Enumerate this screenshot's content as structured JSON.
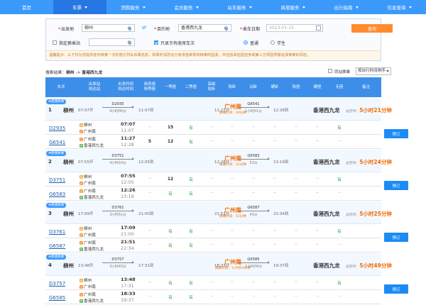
{
  "nav": {
    "items": [
      {
        "label": "首页",
        "caret": false,
        "active": false
      },
      {
        "label": "车票",
        "caret": true,
        "active": true
      },
      {
        "label": "团购服务",
        "caret": true,
        "active": false
      },
      {
        "label": "会员服务",
        "caret": true,
        "active": false
      },
      {
        "label": "站车服务",
        "caret": true,
        "active": false
      },
      {
        "label": "商旅服务",
        "caret": true,
        "active": false
      },
      {
        "label": "出行指南",
        "caret": true,
        "active": false
      },
      {
        "label": "信息查询",
        "caret": true,
        "active": false
      }
    ]
  },
  "search": {
    "from_label": "出发地",
    "from_value": "柳州",
    "to_label": "目的地",
    "to_value": "香港西九龙",
    "date_label": "乘车日期",
    "date_value": "2023-01-15",
    "query_label": "查询",
    "transfer_station_label": "指定换乘站",
    "transfer_station_placeholder": "",
    "only_available_label": "只显示有座席车次",
    "only_available_checked": true,
    "ticket_type_options": [
      "普通",
      "学生"
    ],
    "ticket_type_selected": "普通",
    "notice": "温馨提示：以下仅为您提供途中换乘一次的部分列车余票信息，购票时请您充分考虑各种影响换乘的因素，并自愿承担因自身或第三方原因导致延误换乘的风险。"
  },
  "results": {
    "prefix": "搜索结果：",
    "from": "柳州",
    "sep": " -> ",
    "to": "香港西九龙",
    "same_station_label": "同站换乘",
    "sort_label": "按出行时间排序"
  },
  "table": {
    "headers": [
      "车次",
      "出发站\n到达站",
      "出发时间\n到达时间",
      "商务座\n特等座",
      "一等座",
      "二等座",
      "高级\n软卧",
      "软卧",
      "动卧",
      "硬卧",
      "软座",
      "硬座",
      "无座",
      "备注"
    ]
  },
  "journeys": [
    {
      "badge": "便捷换乘",
      "num": "1",
      "from": "柳州",
      "dep_time": "07:07开",
      "seg1": {
        "code": "D2935",
        "dur": "4小时00分"
      },
      "arr1": "11:07到",
      "transfer_station": "广州南",
      "transfer_info": "换乘时间：20分钟",
      "dep2": "11:27开",
      "seg2": {
        "code": "G6541",
        "dur": "1小时01分"
      },
      "arr2": "12:28到",
      "dest": "香港西九龙",
      "total_label": "总历时：",
      "total": "5小时21分钟",
      "legs": [
        {
          "code": "D2935",
          "from_mk": "始",
          "from": "柳州",
          "to_mk": "过",
          "to": "广州南",
          "dep": "07:07",
          "arr": "11:07",
          "seats": [
            "--",
            "15",
            "有",
            "--",
            "--",
            "--",
            "--",
            "--",
            "--",
            "有"
          ]
        },
        {
          "code": "G6541",
          "from_mk": "过",
          "from": "广州南",
          "to_mk": "终",
          "to": "香港西九龙",
          "dep": "11:27",
          "arr": "12:28",
          "seats": [
            "5",
            "12",
            "有",
            "--",
            "--",
            "--",
            "--",
            "--",
            "--",
            "--"
          ]
        }
      ],
      "book_label": "预订"
    },
    {
      "badge": "便捷换乘",
      "num": "2",
      "from": "柳州",
      "dep_time": "07:55开",
      "seg1": {
        "code": "D3751",
        "dur": "4小时10分"
      },
      "arr1": "12:05到",
      "transfer_station": "广州南",
      "transfer_info": "换乘时间：21分钟",
      "dep2": "12:26开",
      "seg2": {
        "code": "G6583",
        "dur": "53分"
      },
      "arr2": "13:19到",
      "dest": "香港西九龙",
      "total_label": "总历时：",
      "total": "5小时24分钟",
      "legs": [
        {
          "code": "D3751",
          "from_mk": "始",
          "from": "柳州",
          "to_mk": "过",
          "to": "广州南",
          "dep": "07:55",
          "arr": "12:05",
          "seats": [
            "--",
            "12",
            "有",
            "--",
            "--",
            "--",
            "--",
            "--",
            "--",
            "有"
          ]
        },
        {
          "code": "G6583",
          "from_mk": "过",
          "from": "广州南",
          "to_mk": "终",
          "to": "香港西九龙",
          "dep": "12:26",
          "arr": "13:19",
          "seats": [
            "--",
            "有",
            "有",
            "--",
            "--",
            "--",
            "--",
            "--",
            "--",
            "--"
          ]
        }
      ],
      "book_label": "预订"
    },
    {
      "badge": "便捷换乘",
      "num": "3",
      "from": "柳州",
      "dep_time": "17:09开",
      "seg1": {
        "code": "D3761",
        "dur": "3小时51分"
      },
      "arr1": "21:00到",
      "transfer_station": "广州南",
      "transfer_info": "换乘时间：51分钟",
      "dep2": "21:51开",
      "seg2": {
        "code": "G6587",
        "dur": "43分"
      },
      "arr2": "22:34到",
      "dest": "香港西九龙",
      "total_label": "总历时：",
      "total": "5小时25分钟",
      "legs": [
        {
          "code": "D3761",
          "from_mk": "始",
          "from": "柳州",
          "to_mk": "过",
          "to": "广州南",
          "dep": "17:09",
          "arr": "21:00",
          "seats": [
            "--",
            "有",
            "有",
            "--",
            "--",
            "--",
            "--",
            "--",
            "--",
            "有"
          ]
        },
        {
          "code": "G6587",
          "from_mk": "过",
          "from": "广州南",
          "to_mk": "终",
          "to": "香港西九龙",
          "dep": "21:51",
          "arr": "22:34",
          "seats": [
            "--",
            "有",
            "有",
            "--",
            "--",
            "--",
            "--",
            "--",
            "--",
            "--"
          ]
        }
      ],
      "book_label": "预订"
    },
    {
      "badge": "便捷换乘",
      "num": "4",
      "from": "柳州",
      "dep_time": "13:48开",
      "seg1": {
        "code": "D3757",
        "dur": "3小时43分"
      },
      "arr1": "17:31到",
      "transfer_station": "广州南",
      "transfer_info": "换乘时间：1小时02分钟",
      "dep2": "18:33开",
      "seg2": {
        "code": "G6585",
        "dur": "1小时04分"
      },
      "arr2": "19:37到",
      "dest": "香港西九龙",
      "total_label": "总历时：",
      "total": "5小时49分钟",
      "legs": [
        {
          "code": "D3757",
          "from_mk": "始",
          "from": "柳州",
          "to_mk": "过",
          "to": "广州南",
          "dep": "13:48",
          "arr": "17:31",
          "seats": [
            "--",
            "有",
            "有",
            "--",
            "--",
            "--",
            "--",
            "--",
            "--",
            "有"
          ]
        },
        {
          "code": "G6585",
          "from_mk": "过",
          "from": "广州南",
          "to_mk": "终",
          "to": "香港西九龙",
          "dep": "18:33",
          "arr": "19:37",
          "seats": [
            "--",
            "有",
            "有",
            "--",
            "--",
            "--",
            "--",
            "--",
            "--",
            "--"
          ]
        }
      ],
      "book_label": "预订"
    }
  ],
  "colors": {
    "nav_bg": "#3b99fc",
    "nav_active": "#2676e3",
    "header_bg": "#3d8ee8",
    "accent_orange": "#f56a00",
    "available_green": "#26a03a",
    "book_button": "#1b8cf5"
  }
}
